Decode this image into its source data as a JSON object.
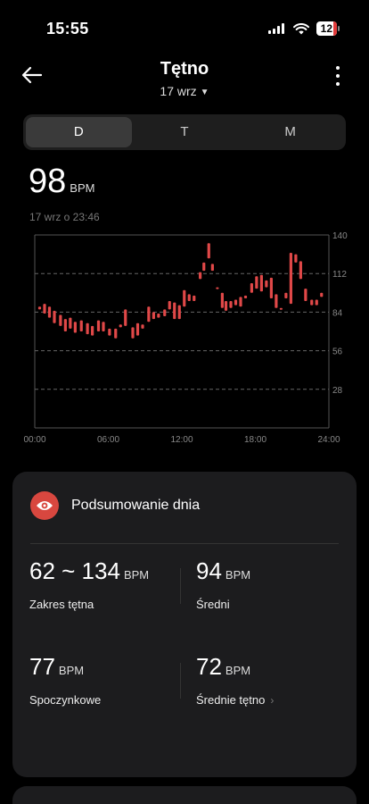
{
  "status_bar": {
    "time": "15:55",
    "battery": "12",
    "icons": [
      "signal-icon",
      "wifi-icon",
      "battery-icon"
    ]
  },
  "header": {
    "title": "Tętno",
    "date": "17 wrz",
    "back_icon": "arrow-left-icon",
    "more_icon": "more-vertical-icon"
  },
  "tabs": [
    {
      "label": "D",
      "active": true
    },
    {
      "label": "T",
      "active": false
    },
    {
      "label": "M",
      "active": false
    }
  ],
  "current": {
    "value": "98",
    "unit": "BPM",
    "timestamp": "17 wrz o 23:46"
  },
  "colors": {
    "accent": "#e04848",
    "badge": "#d8473f",
    "card": "#1c1c1e"
  },
  "chart_data": {
    "type": "candlestick-range",
    "x_ticks": [
      "00:00",
      "06:00",
      "12:00",
      "18:00",
      "24:00"
    ],
    "y_ticks": [
      140,
      112,
      84,
      56,
      28
    ],
    "ylim": [
      0,
      140
    ],
    "xlim": [
      0,
      24
    ],
    "grid": "dashed-horizontal",
    "y_axis_side": "right",
    "series": [
      {
        "ranges": [
          [
            0.4,
            86,
            88
          ],
          [
            0.8,
            83,
            90
          ],
          [
            1.2,
            80,
            88
          ],
          [
            1.6,
            76,
            85
          ],
          [
            2.1,
            74,
            82
          ],
          [
            2.5,
            70,
            79
          ],
          [
            2.9,
            72,
            80
          ],
          [
            3.3,
            69,
            77
          ],
          [
            3.8,
            70,
            78
          ],
          [
            4.3,
            68,
            76
          ],
          [
            4.7,
            67,
            74
          ],
          [
            5.2,
            70,
            78
          ],
          [
            5.6,
            70,
            77
          ],
          [
            6.1,
            67,
            72
          ],
          [
            6.6,
            65,
            72
          ],
          [
            7.0,
            73,
            75
          ],
          [
            7.4,
            74,
            86
          ],
          [
            8.0,
            65,
            73
          ],
          [
            8.4,
            67,
            76
          ],
          [
            8.8,
            72,
            75
          ],
          [
            9.3,
            77,
            88
          ],
          [
            9.7,
            79,
            84
          ],
          [
            10.1,
            80,
            83
          ],
          [
            10.6,
            81,
            86
          ],
          [
            11.0,
            86,
            92
          ],
          [
            11.4,
            79,
            91
          ],
          [
            11.8,
            79,
            89
          ],
          [
            12.2,
            88,
            100
          ],
          [
            12.6,
            92,
            97
          ],
          [
            13.0,
            92,
            96
          ],
          [
            13.5,
            108,
            113
          ],
          [
            13.8,
            114,
            120
          ],
          [
            14.2,
            123,
            134
          ],
          [
            14.5,
            114,
            119
          ],
          [
            14.9,
            101,
            102
          ],
          [
            15.3,
            87,
            98
          ],
          [
            15.6,
            85,
            92
          ],
          [
            16.0,
            87,
            92
          ],
          [
            16.4,
            89,
            93
          ],
          [
            16.8,
            88,
            95
          ],
          [
            17.2,
            94,
            96
          ],
          [
            17.7,
            98,
            105
          ],
          [
            18.1,
            101,
            110
          ],
          [
            18.5,
            99,
            111
          ],
          [
            18.9,
            102,
            107
          ],
          [
            19.3,
            94,
            109
          ],
          [
            19.7,
            87,
            97
          ],
          [
            20.1,
            86,
            87
          ],
          [
            20.5,
            94,
            98
          ],
          [
            20.9,
            90,
            127
          ],
          [
            21.3,
            120,
            126
          ],
          [
            21.7,
            108,
            121
          ],
          [
            22.1,
            92,
            101
          ],
          [
            22.6,
            89,
            93
          ],
          [
            23.0,
            89,
            93
          ],
          [
            23.4,
            95,
            98
          ]
        ]
      }
    ]
  },
  "summary": {
    "title": "Podsumowanie dnia",
    "icon": "eye-icon",
    "range": {
      "value": "62 ~ 134",
      "unit": "BPM",
      "label": "Zakres tętna"
    },
    "average": {
      "value": "94",
      "unit": "BPM",
      "label": "Średni"
    },
    "resting": {
      "value": "77",
      "unit": "BPM",
      "label": "Spoczynkowe"
    },
    "resting_avg": {
      "value": "72",
      "unit": "BPM",
      "label": "Średnie tętno"
    }
  }
}
